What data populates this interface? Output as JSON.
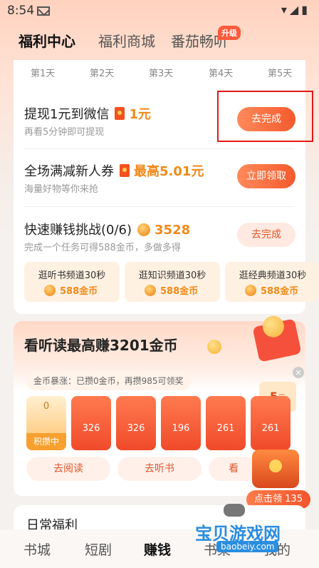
{
  "status": {
    "time": "8:54",
    "icons": "▾◢▮"
  },
  "tabs": [
    {
      "label": "福利中心"
    },
    {
      "label": "福利商城"
    },
    {
      "label": "番茄畅听"
    }
  ],
  "tab_badge": "升级",
  "days": [
    "第1天",
    "第2天",
    "第3天",
    "第4天",
    "第5天"
  ],
  "tasks": [
    {
      "title": "提现1元到微信",
      "reward": "1元",
      "sub": "再看5分钟即可提现",
      "button": "去完成"
    },
    {
      "title": "全场满减新人券",
      "reward": "最高5.01元",
      "sub": "海量好物等你来抢",
      "button": "立即领取"
    },
    {
      "title": "快速赚钱挑战(0/6)",
      "reward": "3528",
      "sub": "完成一个任务可得588金币，多做多得",
      "button": "去完成"
    }
  ],
  "mini_tasks": [
    {
      "title": "逛听书频道30秒",
      "reward": "588金币"
    },
    {
      "title": "逛知识频道30秒",
      "reward": "588金币"
    },
    {
      "title": "逛经典频道30秒",
      "reward": "588金币"
    }
  ],
  "listen": {
    "title": "看听读最高赚3201金币",
    "note": "金币暴涨：已攒0金币，再攒985可领奖",
    "five_value": "5",
    "five_unit": "元",
    "envelopes": [
      "0",
      "326",
      "326",
      "196",
      "261",
      "261"
    ],
    "first_label": "积攒中",
    "pills": [
      "去阅读",
      "去听书",
      "看"
    ],
    "claim": "点击领 135",
    "close": "×"
  },
  "daily": {
    "title": "日常福利"
  },
  "bottom_nav": [
    "书城",
    "短剧",
    "赚钱",
    "书架",
    "我的"
  ],
  "watermark": {
    "big": "宝贝游戏网",
    "small": "baobeiy.com"
  }
}
